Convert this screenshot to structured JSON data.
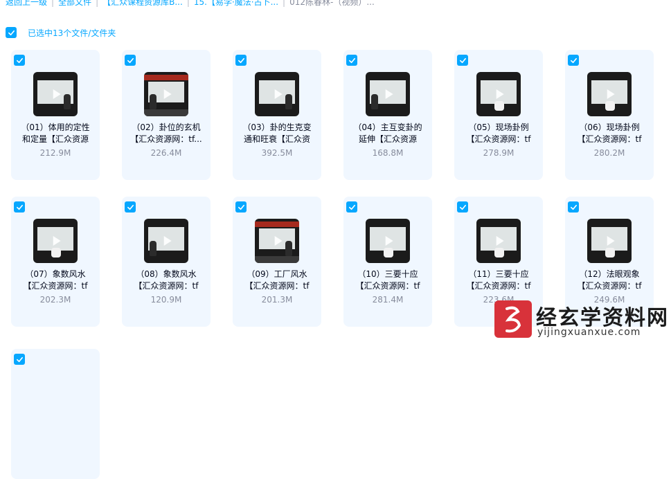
{
  "breadcrumb": [
    {
      "label": "返回上一级",
      "current": false
    },
    {
      "label": "全部文件",
      "current": false
    },
    {
      "label": "【汇众课程资源库B...",
      "current": false
    },
    {
      "label": "15.【易学·魔法·占卜...",
      "current": false
    },
    {
      "label": "012陈春林-（视频）...",
      "current": true
    }
  ],
  "selection": {
    "text": "已选中13个文件/文件夹"
  },
  "files": [
    {
      "line1": "（01）体用的定性",
      "line2": "和定量【汇众资源",
      "size": "212.9M"
    },
    {
      "line1": "（02）卦位的玄机",
      "line2": "【汇众资源网：tf...",
      "size": "226.4M"
    },
    {
      "line1": "（03）卦的生克变",
      "line2": "通和旺衰【汇众资",
      "size": "392.5M"
    },
    {
      "line1": "（04）主互变卦的",
      "line2": "延伸【汇众资源",
      "size": "168.8M"
    },
    {
      "line1": "（05）现场卦例",
      "line2": "【汇众资源网：tf",
      "size": "278.9M"
    },
    {
      "line1": "（06）现场卦例",
      "line2": "【汇众资源网：tf",
      "size": "280.2M"
    },
    {
      "line1": "（07）象数风水",
      "line2": "【汇众资源网：tf",
      "size": "202.3M"
    },
    {
      "line1": "（08）象数风水",
      "line2": "【汇众资源网：tf",
      "size": "120.9M"
    },
    {
      "line1": "（09）工厂风水",
      "line2": "【汇众资源网：tf",
      "size": "201.3M"
    },
    {
      "line1": "（10）三要十应",
      "line2": "【汇众资源网：tf",
      "size": "281.4M"
    },
    {
      "line1": "（11）三要十应",
      "line2": "【汇众资源网：tf",
      "size": "223.6M"
    },
    {
      "line1": "（12）法眼观象",
      "line2": "【汇众资源网：tf",
      "size": "249.6M"
    }
  ],
  "watermark": {
    "title": "经玄学资料网",
    "url": "yijingxuanxue.com"
  },
  "colors": {
    "accent": "#06a7ff",
    "card_bg": "#f0f7ff",
    "muted": "#878c9c"
  }
}
